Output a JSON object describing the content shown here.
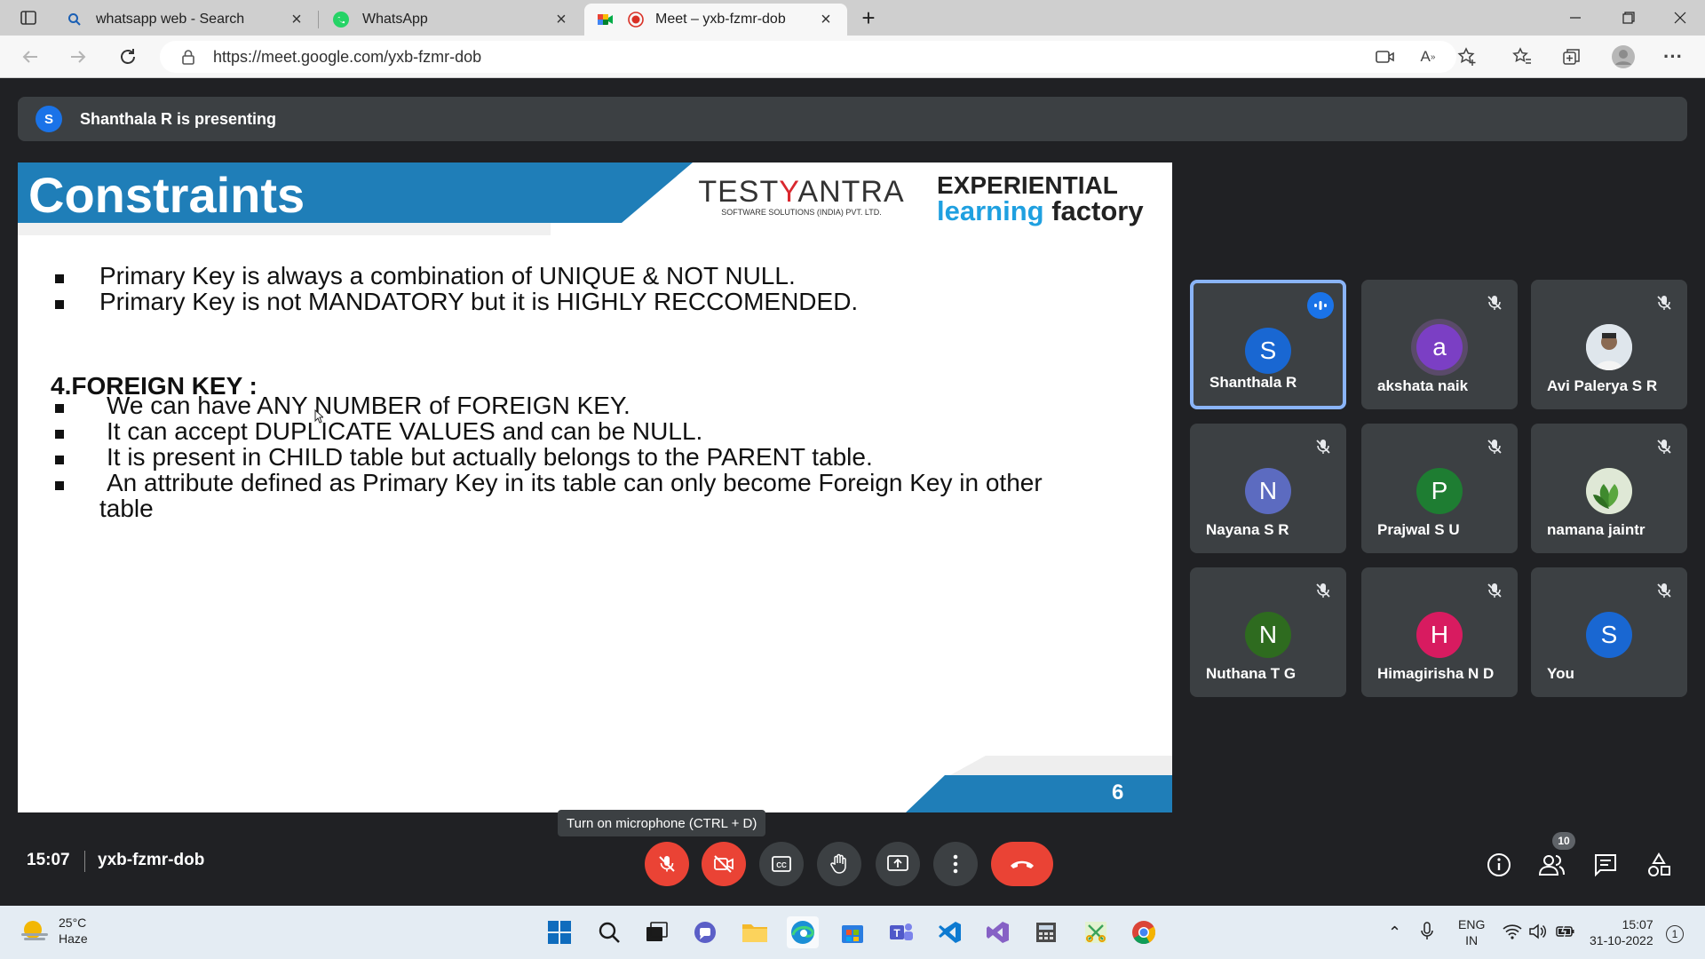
{
  "browser": {
    "tabs": [
      {
        "title": "whatsapp web - Search",
        "icon": "search-icon"
      },
      {
        "title": "WhatsApp",
        "icon": "whatsapp-icon"
      },
      {
        "title": "Meet – yxb-fzmr-dob",
        "icon": "meet-icon"
      }
    ],
    "url": "https://meet.google.com/yxb-fzmr-dob"
  },
  "meet": {
    "presenter_initial": "S",
    "presenting_text": "Shanthala R is presenting",
    "slide": {
      "title": "Constraints",
      "logo_testyantra_a": "TEST",
      "logo_testyantra_b": "Y",
      "logo_testyantra_c": "ANTRA",
      "logo_testyantra_sub": "SOFTWARE SOLUTIONS (INDIA) PVT. LTD.",
      "logo_ef_line1": "EXPERIENTIAL",
      "logo_ef_line2a": "learning",
      "logo_ef_line2b": " factory",
      "pk_bullets": [
        "Primary Key is always a combination of UNIQUE & NOT NULL.",
        "Primary Key is not MANDATORY but it is HIGHLY RECCOMENDED."
      ],
      "fk_heading": "4.FOREIGN KEY :",
      "fk_bullets": [
        "We can have ANY NUMBER of FOREIGN KEY.",
        "It can accept DUPLICATE VALUES and can be NULL.",
        "It is present in CHILD table but actually belongs to the PARENT table.",
        "An attribute defined as Primary Key in its table can only become Foreign Key in other",
        "table"
      ],
      "page_number": "6"
    },
    "participants": [
      {
        "name": "Shanthala R",
        "initial": "S",
        "color": "#1967d2",
        "speaking": true
      },
      {
        "name": "akshata naik",
        "initial": "a",
        "color": "#7b3fc4",
        "speaking": false
      },
      {
        "name": "Avi Palerya S R",
        "initial": "",
        "color": "#c9cfd6",
        "speaking": false
      },
      {
        "name": "Nayana S R",
        "initial": "N",
        "color": "#5c6bc0",
        "speaking": false
      },
      {
        "name": "Prajwal S U",
        "initial": "P",
        "color": "#1e7d32",
        "speaking": false
      },
      {
        "name": "namana jaintr",
        "initial": "",
        "color": "#6a9b4a",
        "speaking": false
      },
      {
        "name": "Nuthana T G",
        "initial": "N",
        "color": "#2e6b1f",
        "speaking": false
      },
      {
        "name": "Himagirisha N D",
        "initial": "H",
        "color": "#d81b60",
        "speaking": false
      },
      {
        "name": "You",
        "initial": "S",
        "color": "#1967d2",
        "speaking": false
      }
    ],
    "tooltip": "Turn on microphone (CTRL + D)",
    "time": "15:07",
    "meeting_code": "yxb-fzmr-dob",
    "participant_count": "10"
  },
  "taskbar": {
    "temperature": "25°C",
    "weather": "Haze",
    "lang1": "ENG",
    "lang2": "IN",
    "time": "15:07",
    "date": "31-10-2022",
    "notifications": "1"
  }
}
